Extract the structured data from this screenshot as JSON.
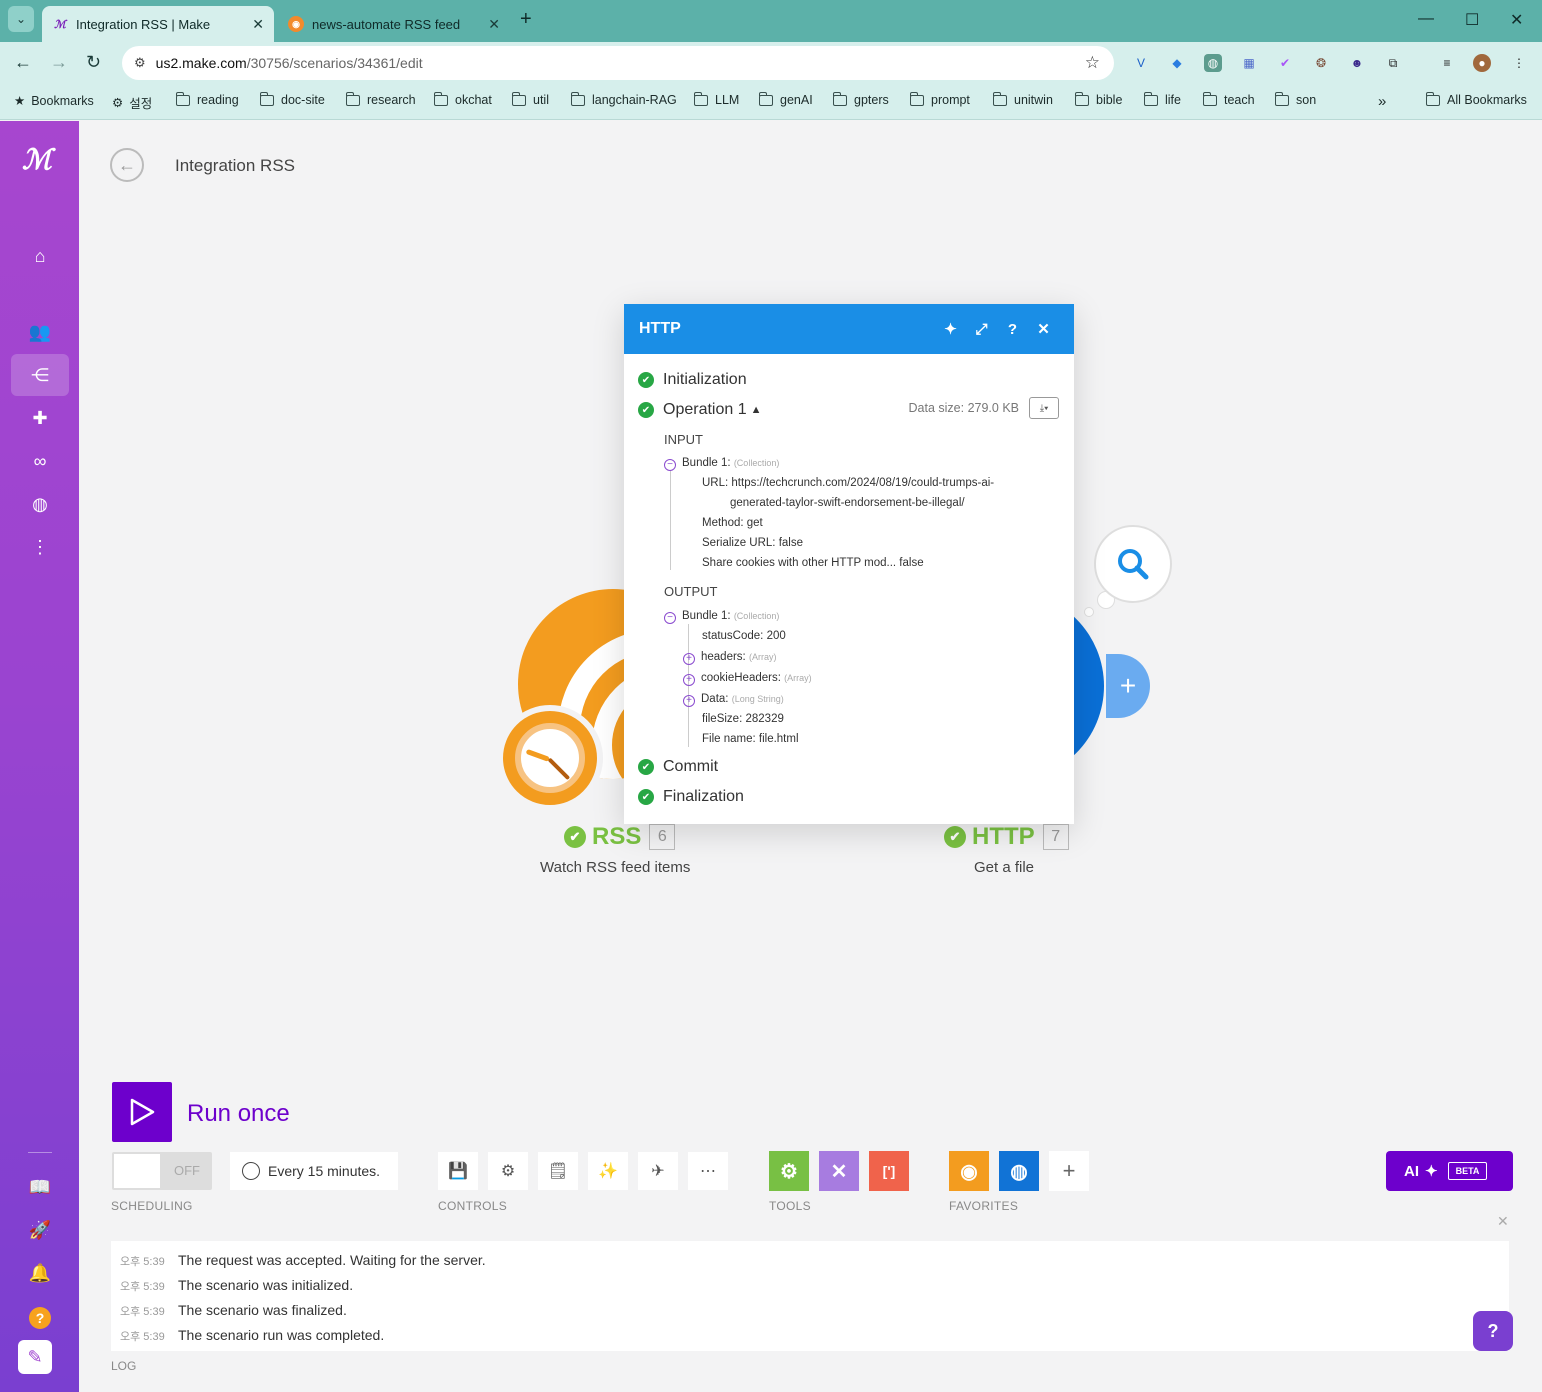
{
  "browser": {
    "tabs": [
      {
        "title": "Integration RSS | Make",
        "active": true
      },
      {
        "title": "news-automate RSS feed",
        "active": false
      }
    ],
    "url_host": "us2.make.com",
    "url_path": "/30756/scenarios/34361/edit",
    "bookmarks": [
      "Bookmarks",
      "설정",
      "reading",
      "doc-site",
      "research",
      "okchat",
      "util",
      "langchain-RAG",
      "LLM",
      "genAI",
      "gpters",
      "prompt",
      "unitwin",
      "bible",
      "life",
      "teach",
      "son"
    ],
    "all_bookmarks": "All Bookmarks",
    "more": "»"
  },
  "scenario": {
    "title": "Integration RSS"
  },
  "modules": {
    "rss": {
      "name": "RSS",
      "number": "6",
      "subtitle": "Watch RSS feed items",
      "color": "#f39c1f"
    },
    "http": {
      "name": "HTTP",
      "number": "7",
      "subtitle": "Get a file",
      "color": "#0a6fd6"
    }
  },
  "popup": {
    "title": "HTTP",
    "stages": {
      "initialization": "Initialization",
      "operation": "Operation 1",
      "commit": "Commit",
      "finalization": "Finalization"
    },
    "data_size": "Data size: 279.0 KB",
    "input_label": "INPUT",
    "output_label": "OUTPUT",
    "input_bundle": {
      "label": "Bundle 1:",
      "type": "(Collection)",
      "url_key": "URL:",
      "url_line1": "https://techcrunch.com/2024/08/19/could-trumps-ai-",
      "url_line2": "generated-taylor-swift-endorsement-be-illegal/",
      "method_key": "Method:",
      "method_val": "get",
      "serialize_key": "Serialize URL:",
      "serialize_val": "false",
      "share_key": "Share cookies with other HTTP mod...",
      "share_val": "false"
    },
    "output_bundle": {
      "label": "Bundle 1:",
      "type": "(Collection)",
      "status_key": "statusCode:",
      "status_val": "200",
      "headers_key": "headers:",
      "headers_type": "(Array)",
      "cookie_key": "cookieHeaders:",
      "cookie_type": "(Array)",
      "data_key": "Data:",
      "data_type": "(Long String)",
      "filesize_key": "fileSize:",
      "filesize_val": "282329",
      "filename_key": "File name:",
      "filename_val": "file.html"
    }
  },
  "toolbar": {
    "run_once": "Run once",
    "toggle_off": "OFF",
    "schedule": "Every 15 minutes.",
    "scheduling_label": "SCHEDULING",
    "controls_label": "CONTROLS",
    "tools_label": "TOOLS",
    "favorites_label": "FAVORITES",
    "ai_label": "AI",
    "beta": "BETA"
  },
  "log": {
    "label": "LOG",
    "entries": [
      {
        "time": "오후 5:39",
        "message": "The request was accepted. Waiting for the server."
      },
      {
        "time": "오후 5:39",
        "message": "The scenario was initialized."
      },
      {
        "time": "오후 5:39",
        "message": "The scenario was finalized."
      },
      {
        "time": "오후 5:39",
        "message": "The scenario run was completed."
      }
    ]
  },
  "colors": {
    "brand": "#6d00cc",
    "popup_header": "#1a8ee6",
    "success": "#28a745"
  }
}
